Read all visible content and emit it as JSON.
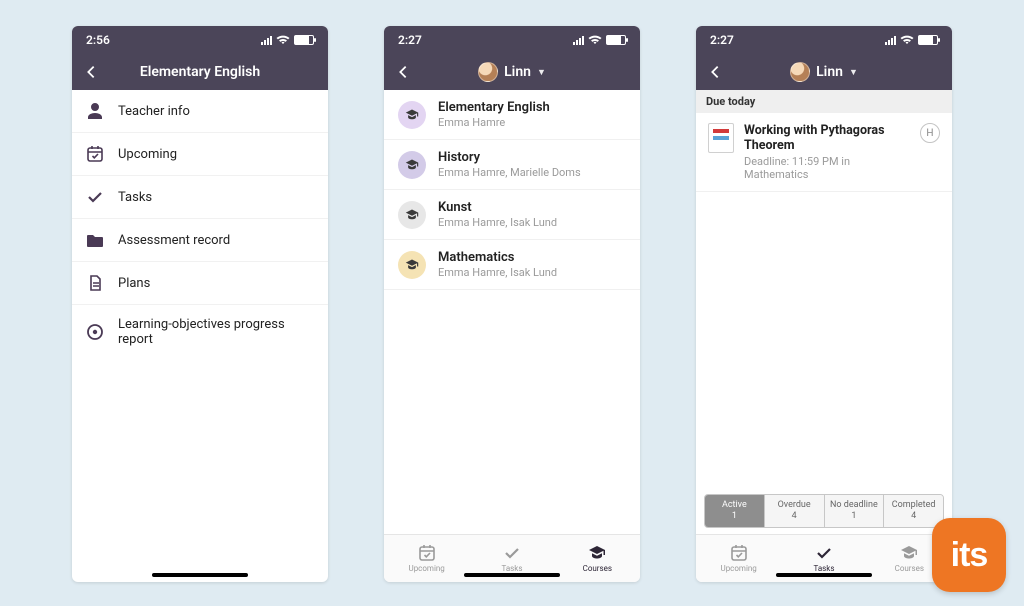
{
  "screen1": {
    "time": "2:56",
    "title": "Elementary English",
    "menu": [
      {
        "label": "Teacher info"
      },
      {
        "label": "Upcoming"
      },
      {
        "label": "Tasks"
      },
      {
        "label": "Assessment record"
      },
      {
        "label": "Plans"
      },
      {
        "label": "Learning-objectives progress report"
      }
    ]
  },
  "screen2": {
    "time": "2:27",
    "user": "Linn",
    "courses": [
      {
        "name": "Elementary English",
        "teachers": "Emma Hamre",
        "color": "#e3d5f2"
      },
      {
        "name": "History",
        "teachers": "Emma Hamre, Marielle Doms",
        "color": "#d3cbe8"
      },
      {
        "name": "Kunst",
        "teachers": "Emma Hamre, Isak Lund",
        "color": "#e7e7e7"
      },
      {
        "name": "Mathematics",
        "teachers": "Emma Hamre, Isak Lund",
        "color": "#f5e3b4"
      }
    ],
    "tabs": {
      "upcoming": "Upcoming",
      "tasks": "Tasks",
      "courses": "Courses"
    }
  },
  "screen3": {
    "time": "2:27",
    "user": "Linn",
    "section": "Due today",
    "task": {
      "title": "Working with Pythagoras Theorem",
      "meta": "Deadline: 11:59 PM in Mathematics",
      "badge": "H"
    },
    "filters": [
      {
        "label": "Active",
        "count": "1",
        "active": true
      },
      {
        "label": "Overdue",
        "count": "4",
        "active": false
      },
      {
        "label": "No deadline",
        "count": "1",
        "active": false
      },
      {
        "label": "Completed",
        "count": "4",
        "active": false
      }
    ],
    "tabs": {
      "upcoming": "Upcoming",
      "tasks": "Tasks",
      "courses": "Courses"
    }
  },
  "brand": "its"
}
